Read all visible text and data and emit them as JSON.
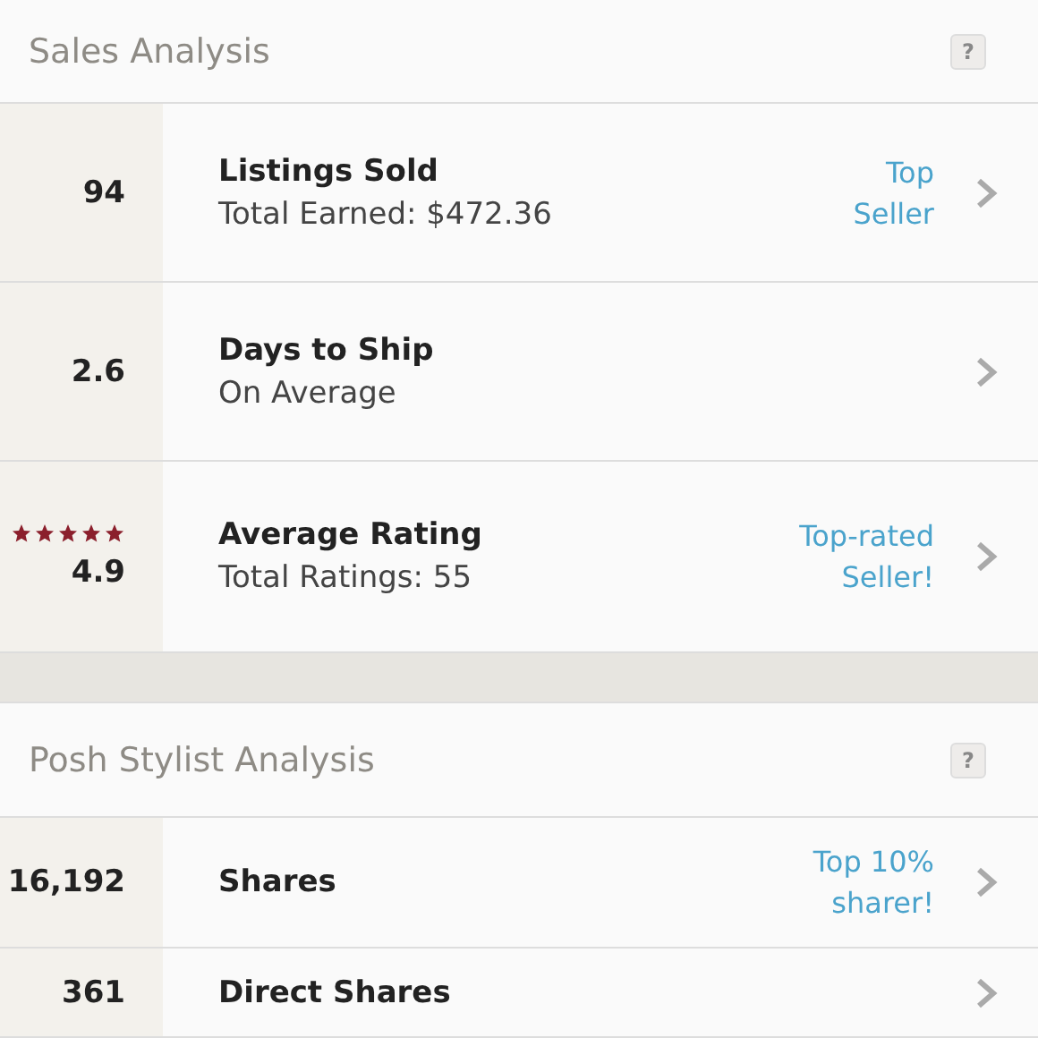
{
  "sections": [
    {
      "title": "Sales Analysis",
      "help": "?",
      "rows": [
        {
          "value": "Listings Sold",
          "metric": "94",
          "subtitle": "Total Earned: $472.36",
          "badge": "Top\nSeller"
        },
        {
          "value": "Days to Ship",
          "metric": "2.6",
          "subtitle": "On Average"
        },
        {
          "value": "Average Rating",
          "metric": "4.9",
          "stars": 5,
          "subtitle": "Total Ratings: 55",
          "badge": "Top-rated\nSeller!"
        }
      ]
    },
    {
      "title": "Posh Stylist Analysis",
      "help": "?",
      "rows": [
        {
          "value": "Shares",
          "metric": "16,192",
          "badge": "Top 10%\nsharer!"
        },
        {
          "value": "Direct Shares",
          "metric": "361"
        }
      ]
    }
  ]
}
